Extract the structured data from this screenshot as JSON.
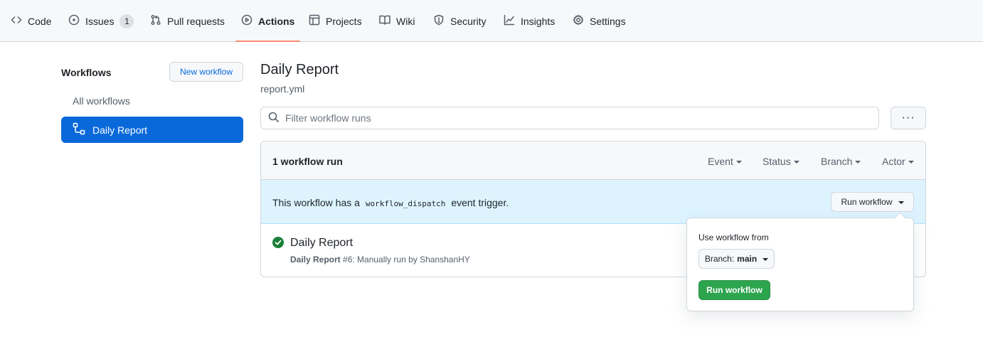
{
  "repo_nav": {
    "tabs": [
      {
        "label": "Code",
        "icon": "code-icon"
      },
      {
        "label": "Issues",
        "icon": "issue-opened-icon",
        "count": "1"
      },
      {
        "label": "Pull requests",
        "icon": "git-pull-request-icon"
      },
      {
        "label": "Actions",
        "icon": "play-icon",
        "selected": true
      },
      {
        "label": "Projects",
        "icon": "table-icon"
      },
      {
        "label": "Wiki",
        "icon": "book-icon"
      },
      {
        "label": "Security",
        "icon": "shield-icon"
      },
      {
        "label": "Insights",
        "icon": "graph-icon"
      },
      {
        "label": "Settings",
        "icon": "gear-icon"
      }
    ]
  },
  "sidebar": {
    "title": "Workflows",
    "new_workflow_label": "New workflow",
    "items": [
      {
        "label": "All workflows"
      },
      {
        "label": "Daily Report",
        "icon": "workflow-icon",
        "selected": true
      }
    ]
  },
  "main": {
    "title": "Daily Report",
    "file": "report.yml",
    "filter_placeholder": "Filter workflow runs",
    "more_label": "···",
    "runs_count": "1 workflow run",
    "filters": [
      "Event",
      "Status",
      "Branch",
      "Actor"
    ],
    "dispatch": {
      "before": "This workflow has a",
      "code": "workflow_dispatch",
      "after": "event trigger.",
      "button": "Run workflow"
    },
    "run": {
      "status_icon": "check-circle-fill-icon",
      "title": "Daily Report",
      "subtitle_bold": "Daily Report",
      "subtitle_rest": " #6: Manually run by ShanshanHY"
    }
  },
  "popover": {
    "label": "Use workflow from",
    "branch_prefix": "Branch:",
    "branch": "main",
    "submit": "Run workflow"
  },
  "colors": {
    "accent": "#0969da",
    "selected_underline": "#fd8c73",
    "success": "#2da44e",
    "info_bg": "#ddf4ff"
  }
}
